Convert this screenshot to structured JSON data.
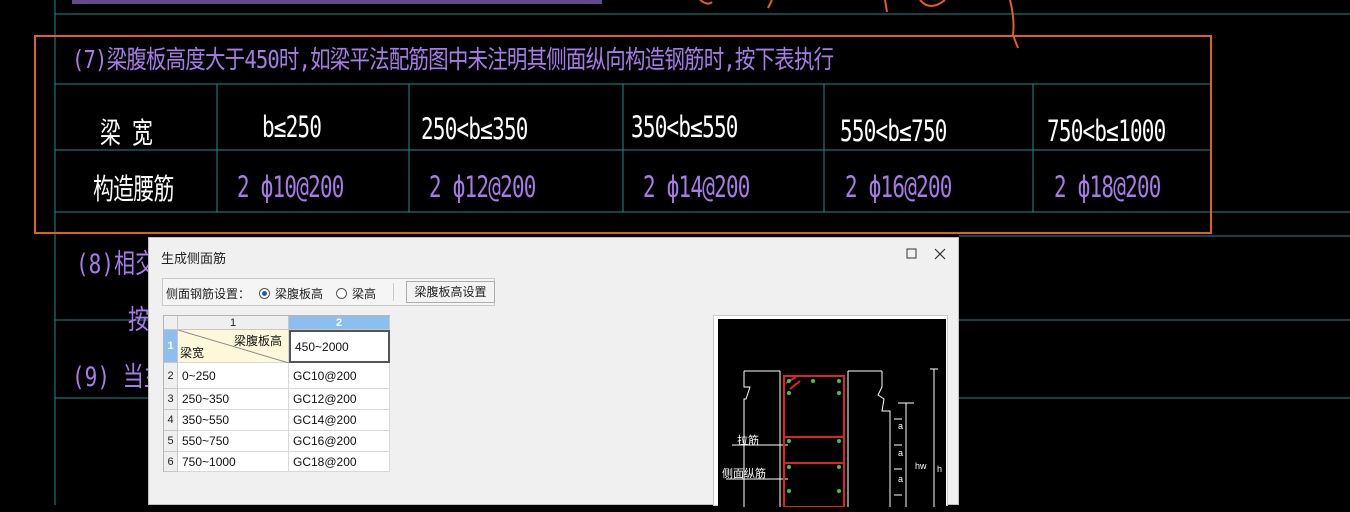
{
  "cad": {
    "note7": "(7)梁腹板高度大于450时,如梁平法配筋图中未注明其侧面纵向构造钢筋时,按下表执行",
    "row1_label": "梁 宽",
    "row2_label": "构造腰筋",
    "widths": [
      "b≤250",
      "250<b≤350",
      "350<b≤550",
      "550<b≤750",
      "750<b≤1000"
    ],
    "bars": [
      "2 ф10@200",
      "2 ф12@200",
      "2 ф14@200",
      "2 ф16@200",
      "2 ф18@200"
    ],
    "side_8": "(8)相交",
    "side_an": "按",
    "side_9": "(9) 当主",
    "colors": {
      "annotation": "#e2611a",
      "table_line": "#1b8c8c",
      "text_purple": "#a97be8"
    }
  },
  "dialog": {
    "title": "生成侧面筋",
    "maximize_icon": "maximize-icon",
    "close_icon": "close-icon",
    "toolbar": {
      "label": "侧面钢筋设置：",
      "radio_web_height": "梁腹板高",
      "radio_beam_height": "梁高",
      "selected": "梁腹板高",
      "settings_button": "梁腹板高设置"
    },
    "grid": {
      "col_headers": [
        "1",
        "2"
      ],
      "corner_top": "梁腹板高",
      "corner_bottom": "梁宽",
      "header_value": "450~2000",
      "rows": [
        {
          "num": "1"
        },
        {
          "num": "2",
          "width": "0~250",
          "rebar": "GC10@200"
        },
        {
          "num": "3",
          "width": "250~350",
          "rebar": "GC12@200"
        },
        {
          "num": "4",
          "width": "350~550",
          "rebar": "GC14@200"
        },
        {
          "num": "5",
          "width": "550~750",
          "rebar": "GC16@200"
        },
        {
          "num": "6",
          "width": "750~1000",
          "rebar": "GC18@200"
        }
      ]
    },
    "preview": {
      "label_tie": "拉筋",
      "label_side": "侧面纵筋",
      "dim_a": "a",
      "dim_hw": "hw",
      "dim_h": "h"
    }
  }
}
